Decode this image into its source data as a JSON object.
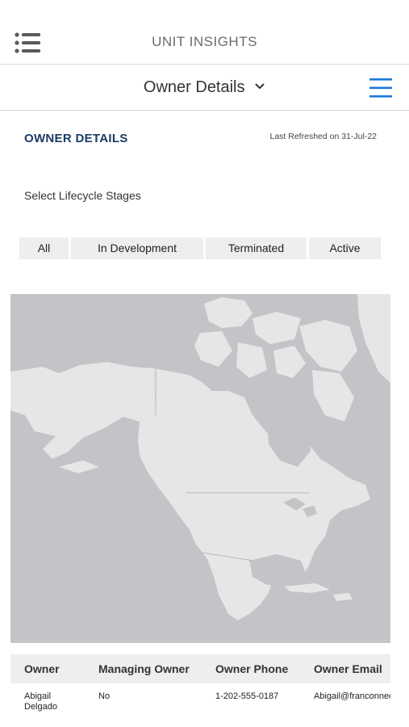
{
  "header": {
    "app_title": "UNIT INSIGHTS",
    "list_icon": "list-icon",
    "menu_icon": "hamburger-menu-icon",
    "accent_color": "#1a7ad9"
  },
  "nav": {
    "selected_page": "Owner Details",
    "dropdown_icon": "chevron-down-icon"
  },
  "section": {
    "title": "OWNER DETAILS",
    "last_refreshed": "Last Refreshed on 31-Jul-22",
    "title_color": "#1c3b63"
  },
  "lifecycle": {
    "label": "Select Lifecycle Stages",
    "stages": [
      "All",
      "In Development",
      "Terminated",
      "Active"
    ]
  },
  "map": {
    "description_icon": "north-america-map"
  },
  "table": {
    "headers": [
      "Owner",
      "Managing Owner",
      "Owner Phone",
      "Owner Email"
    ],
    "rows": [
      {
        "owner": "Abigail Delgado",
        "managing_owner": "No",
        "owner_phone": "1-202-555-0187",
        "owner_email": "Abigail@franconnect.com"
      }
    ]
  }
}
